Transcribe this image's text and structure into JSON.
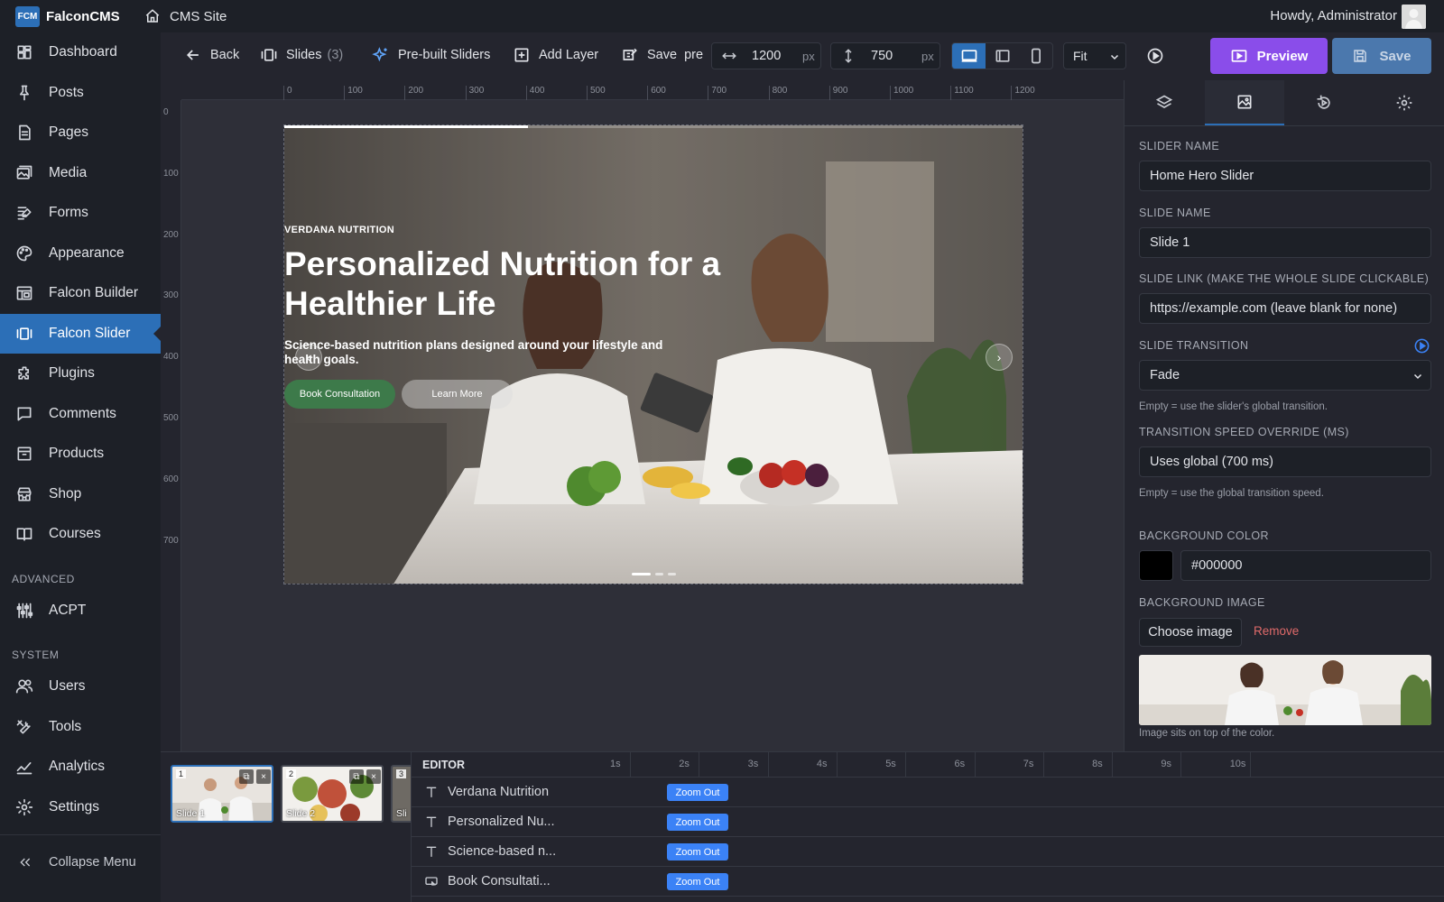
{
  "adminbar": {
    "brand_logo": "FCM",
    "brand_name": "FalconCMS",
    "site_label": "CMS Site",
    "howdy": "Howdy, Administrator"
  },
  "sidebar": {
    "items": [
      {
        "label": "Dashboard",
        "icon": "dashboard-icon"
      },
      {
        "label": "Posts",
        "icon": "pin-icon"
      },
      {
        "label": "Pages",
        "icon": "page-icon"
      },
      {
        "label": "Media",
        "icon": "media-icon"
      },
      {
        "label": "Forms",
        "icon": "forms-icon"
      },
      {
        "label": "Appearance",
        "icon": "palette-icon"
      },
      {
        "label": "Falcon Builder",
        "icon": "builder-icon"
      },
      {
        "label": "Falcon Slider",
        "icon": "slider-icon",
        "active": true
      },
      {
        "label": "Plugins",
        "icon": "plugin-icon"
      },
      {
        "label": "Comments",
        "icon": "comment-icon"
      },
      {
        "label": "Products",
        "icon": "box-icon"
      },
      {
        "label": "Shop",
        "icon": "store-icon"
      },
      {
        "label": "Courses",
        "icon": "book-icon"
      }
    ],
    "section_advanced": "ADVANCED",
    "advanced_items": [
      {
        "label": "ACPT",
        "icon": "acpt-icon"
      }
    ],
    "section_system": "SYSTEM",
    "system_items": [
      {
        "label": "Users",
        "icon": "users-icon"
      },
      {
        "label": "Tools",
        "icon": "tools-icon"
      },
      {
        "label": "Analytics",
        "icon": "analytics-icon"
      },
      {
        "label": "Settings",
        "icon": "gear-icon"
      }
    ],
    "collapse_label": "Collapse Menu"
  },
  "toolbar": {
    "back": "Back",
    "slides": "Slides",
    "slides_count": "(3)",
    "prebuilt": "Pre-built Sliders",
    "add_layer": "Add Layer",
    "save_preset": "Save",
    "save_preset_tail": "pre",
    "width_value": "1200",
    "height_value": "750",
    "unit": "px",
    "fit": "Fit",
    "preview": "Preview",
    "save": "Save",
    "active_device": "desktop"
  },
  "ruler": {
    "h_ticks": [
      "0",
      "100",
      "200",
      "300",
      "400",
      "500",
      "600",
      "700",
      "800",
      "900",
      "1000",
      "1100",
      "1200"
    ],
    "v_ticks": [
      "0",
      "100",
      "200",
      "300",
      "400",
      "500",
      "600",
      "700"
    ]
  },
  "slide": {
    "kicker": "VERDANA NUTRITION",
    "headline": "Personalized Nutrition for a Healthier Life",
    "subline": "Science-based nutrition plans designed around your lifestyle and health goals.",
    "cta_primary": "Book Consultation",
    "cta_secondary": "Learn More",
    "prev_arrow": "‹",
    "next_arrow": "›",
    "progress": 0.33,
    "dots": 3,
    "active_dot": 1
  },
  "panel": {
    "slider_name_label": "SLIDER NAME",
    "slider_name": "Home Hero Slider",
    "slide_name_label": "SLIDE NAME",
    "slide_name": "Slide 1",
    "slide_link_label": "SLIDE LINK (MAKE THE WHOLE SLIDE CLICKABLE)",
    "slide_link_placeholder": "https://example.com  (leave blank for none)",
    "transition_label": "SLIDE TRANSITION",
    "transition_value": "Fade",
    "transition_hint": "Empty = use the slider's global transition.",
    "speed_label": "TRANSITION SPEED OVERRIDE (MS)",
    "speed_placeholder": "Uses global (700 ms)",
    "speed_hint": "Empty = use the global transition speed.",
    "bg_color_label": "BACKGROUND COLOR",
    "bg_color_value": "#000000",
    "bg_image_label": "BACKGROUND IMAGE",
    "choose_image": "Choose image",
    "remove": "Remove",
    "image_hint": "Image sits on top of the color."
  },
  "slides_strip": {
    "thumbs": [
      {
        "num": "1",
        "name": "Slide 1",
        "active": true
      },
      {
        "num": "2",
        "name": "Slide 2",
        "active": false
      },
      {
        "num": "3",
        "name": "Sli",
        "active": false
      }
    ]
  },
  "timeline": {
    "header": "EDITOR",
    "seconds": [
      "1s",
      "2s",
      "3s",
      "4s",
      "5s",
      "6s",
      "7s",
      "8s",
      "9s",
      "10s"
    ],
    "rows": [
      {
        "label": "Verdana Nutrition",
        "icon": "text-icon",
        "chip": "Zoom Out"
      },
      {
        "label": "Personalized Nu...",
        "icon": "text-icon",
        "chip": "Zoom Out"
      },
      {
        "label": "Science-based n...",
        "icon": "text-icon",
        "chip": "Zoom Out"
      },
      {
        "label": "Book Consultati...",
        "icon": "button-icon",
        "chip": "Zoom Out"
      }
    ]
  },
  "colors": {
    "accent": "#2c6fb7",
    "preview": "#8a4dea",
    "save": "#4b78ad",
    "cta_green": "#3d7a4a",
    "chip": "#3b82f6",
    "remove": "#e06a6a"
  }
}
